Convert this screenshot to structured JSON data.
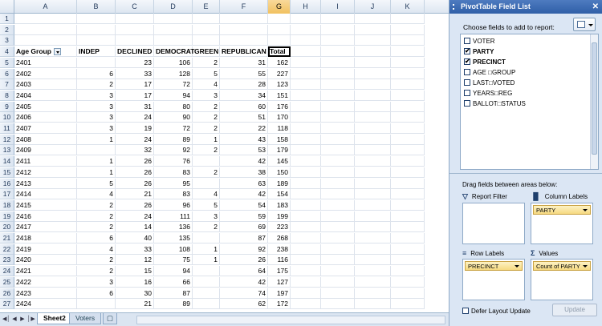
{
  "columns": [
    "A",
    "B",
    "C",
    "D",
    "E",
    "F",
    "G",
    "H",
    "I",
    "J",
    "K"
  ],
  "selected_column": "G",
  "row_numbers": [
    "1",
    "2",
    "3",
    "4",
    "5",
    "6",
    "7",
    "8",
    "9",
    "10",
    "11",
    "12",
    "13",
    "14",
    "15",
    "16",
    "17",
    "18",
    "19",
    "20",
    "21",
    "22",
    "23",
    "24",
    "25",
    "26",
    "27"
  ],
  "pivot_headers": [
    "Age Group",
    "INDEP",
    "DECLINED",
    "DEMOCRAT",
    "GREEN",
    "REPUBLICAN",
    "Total"
  ],
  "pivot_rows": [
    [
      "2401",
      "",
      "23",
      "106",
      "2",
      "31",
      "162"
    ],
    [
      "2402",
      "6",
      "33",
      "128",
      "5",
      "55",
      "227"
    ],
    [
      "2403",
      "2",
      "17",
      "72",
      "4",
      "28",
      "123"
    ],
    [
      "2404",
      "3",
      "17",
      "94",
      "3",
      "34",
      "151"
    ],
    [
      "2405",
      "3",
      "31",
      "80",
      "2",
      "60",
      "176"
    ],
    [
      "2406",
      "3",
      "24",
      "90",
      "2",
      "51",
      "170"
    ],
    [
      "2407",
      "3",
      "19",
      "72",
      "2",
      "22",
      "118"
    ],
    [
      "2408",
      "1",
      "24",
      "89",
      "1",
      "43",
      "158"
    ],
    [
      "2409",
      "",
      "32",
      "92",
      "2",
      "53",
      "179"
    ],
    [
      "2411",
      "1",
      "26",
      "76",
      "",
      "42",
      "145"
    ],
    [
      "2412",
      "1",
      "26",
      "83",
      "2",
      "38",
      "150"
    ],
    [
      "2413",
      "5",
      "26",
      "95",
      "",
      "63",
      "189"
    ],
    [
      "2414",
      "4",
      "21",
      "83",
      "4",
      "42",
      "154"
    ],
    [
      "2415",
      "2",
      "26",
      "96",
      "5",
      "54",
      "183"
    ],
    [
      "2416",
      "2",
      "24",
      "111",
      "3",
      "59",
      "199"
    ],
    [
      "2417",
      "2",
      "14",
      "136",
      "2",
      "69",
      "223"
    ],
    [
      "2418",
      "6",
      "40",
      "135",
      "",
      "87",
      "268"
    ],
    [
      "2419",
      "4",
      "33",
      "108",
      "1",
      "92",
      "238"
    ],
    [
      "2420",
      "2",
      "12",
      "75",
      "1",
      "26",
      "116"
    ],
    [
      "2421",
      "2",
      "15",
      "94",
      "",
      "64",
      "175"
    ],
    [
      "2422",
      "3",
      "16",
      "66",
      "",
      "42",
      "127"
    ],
    [
      "2423",
      "6",
      "30",
      "87",
      "",
      "74",
      "197"
    ],
    [
      "2424",
      "",
      "21",
      "89",
      "",
      "62",
      "172"
    ]
  ],
  "tabs": [
    {
      "label": "Sheet2",
      "active": true
    },
    {
      "label": "Voters",
      "active": false
    }
  ],
  "pane": {
    "title": "PivotTable Field List",
    "choose_label": "Choose fields to add to report:",
    "fields": [
      {
        "label": "VOTER",
        "checked": false
      },
      {
        "label": "PARTY",
        "checked": true
      },
      {
        "label": "PRECINCT",
        "checked": true
      },
      {
        "label": "AGE □GROUP",
        "checked": false
      },
      {
        "label": "LAST□VOTED",
        "checked": false
      },
      {
        "label": "YEARS□REG",
        "checked": false
      },
      {
        "label": "BALLOT□STATUS",
        "checked": false
      }
    ],
    "drag_label": "Drag fields between areas below:",
    "report_filter_label": "Report Filter",
    "column_labels_label": "Column Labels",
    "row_labels_label": "Row Labels",
    "values_label": "Values",
    "column_item": "PARTY",
    "row_item": "PRECINCT",
    "values_item": "Count of PARTY",
    "defer_label": "Defer Layout Update",
    "update_label": "Update",
    "close_glyph": "✕",
    "filter_icon_glyph": "▽",
    "columns_icon_glyph": "▐▌",
    "rows_icon_glyph": "≡",
    "values_icon_glyph": "Σ"
  },
  "colors": {
    "selected_column": "#f1c15f",
    "pane_background": "#dbe6f4",
    "pane_title": "#2f5fa7",
    "field_chip": "#f6d980"
  }
}
